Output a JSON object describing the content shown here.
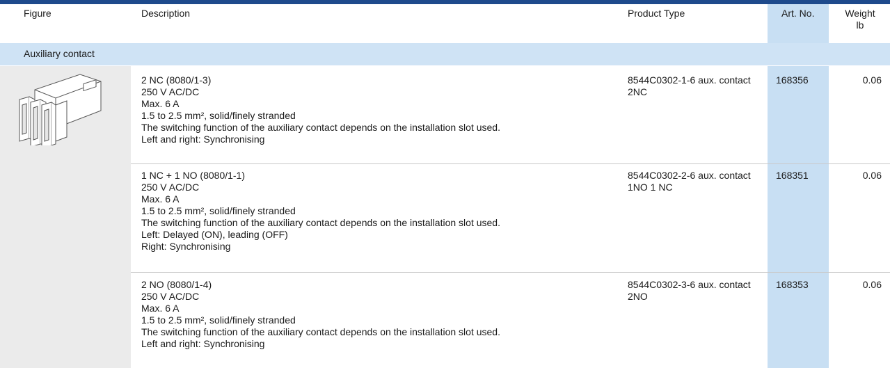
{
  "header": {
    "figure": "Figure",
    "description": "Description",
    "product_type": "Product Type",
    "art_no": "Art. No.",
    "weight_line1": "Weight",
    "weight_line2": "lb"
  },
  "group": {
    "label": "Auxiliary contact",
    "image_icon": "auxiliary-contact-block"
  },
  "colors": {
    "top_bar": "#1e4a8c",
    "group_row": "#cfe3f5",
    "art_no_column": "#c8dff3",
    "figure_cell": "#ebebeb"
  },
  "rows": [
    {
      "description": [
        "2 NC (8080/1-3)",
        "250 V AC/DC",
        "Max. 6 A",
        "1.5 to 2.5 mm², solid/finely stranded",
        "The switching function of the auxiliary contact depends on the installation slot used.",
        "Left and right: Synchronising"
      ],
      "product_type": [
        "8544C0302-1-6 aux. contact",
        "2NC"
      ],
      "art_no": "168356",
      "weight": "0.06"
    },
    {
      "description": [
        "1 NC + 1 NO (8080/1-1)",
        "250 V AC/DC",
        "Max. 6 A",
        "1.5 to 2.5 mm², solid/finely stranded",
        "The switching function of the auxiliary contact depends on the installation slot used.",
        "Left: Delayed (ON), leading (OFF)",
        "Right: Synchronising"
      ],
      "product_type": [
        "8544C0302-2-6 aux. contact",
        "1NO 1 NC"
      ],
      "art_no": "168351",
      "weight": "0.06"
    },
    {
      "description": [
        "2 NO (8080/1-4)",
        "250 V AC/DC",
        "Max. 6 A",
        "1.5 to 2.5 mm², solid/finely stranded",
        "The switching function of the auxiliary contact depends on the installation slot used.",
        "Left and right: Synchronising"
      ],
      "product_type": [
        "8544C0302-3-6 aux. contact",
        "2NO"
      ],
      "art_no": "168353",
      "weight": "0.06"
    }
  ]
}
